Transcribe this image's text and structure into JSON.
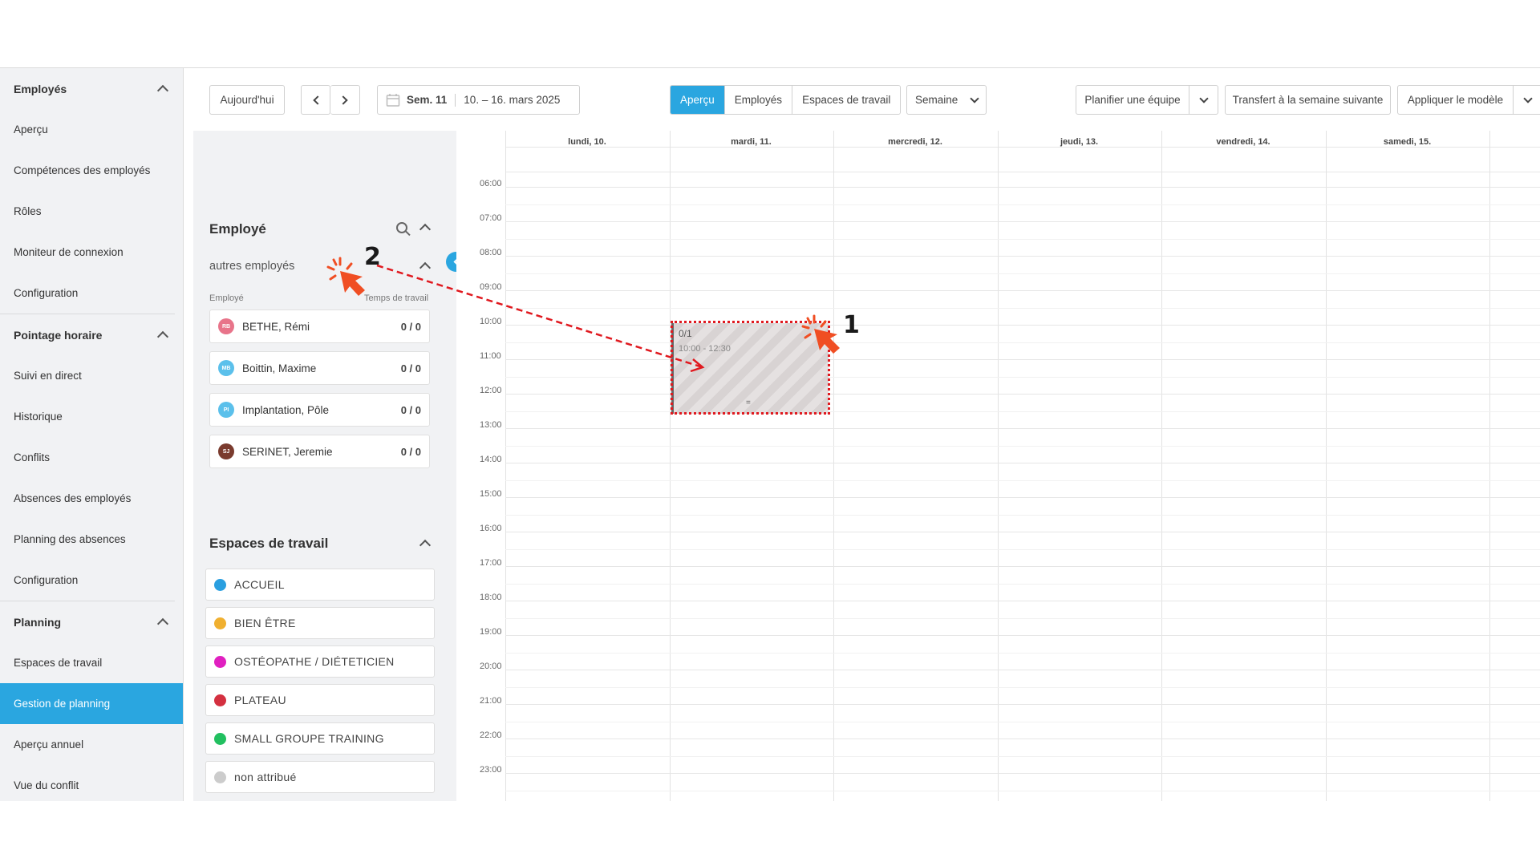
{
  "nav": {
    "sections": [
      {
        "title": "Employés",
        "items": [
          "Aperçu",
          "Compétences des employés",
          "Rôles",
          "Moniteur de connexion",
          "Configuration"
        ]
      },
      {
        "title": "Pointage horaire",
        "items": [
          "Suivi en direct",
          "Historique",
          "Conflits",
          "Absences des employés",
          "Planning des absences",
          "Configuration"
        ]
      },
      {
        "title": "Planning",
        "items": [
          "Espaces de travail",
          "Gestion de planning",
          "Aperçu annuel",
          "Vue du conflit"
        ]
      }
    ],
    "active_item": "Gestion de planning"
  },
  "toolbar": {
    "today": "Aujourd'hui",
    "week_number": "Sem. 11",
    "week_range": "10. – 16. mars 2025",
    "view_tabs": [
      "Aperçu",
      "Employés",
      "Espaces de travail"
    ],
    "active_view": "Aperçu",
    "period": "Semaine",
    "plan_team": "Planifier une équipe",
    "transfer": "Transfert à la semaine suivante",
    "apply_template": "Appliquer le modèle"
  },
  "employee_panel": {
    "title": "Employé",
    "group": "autres employés",
    "col_employee": "Employé",
    "col_time": "Temps de travail",
    "employees": [
      {
        "initials": "RB",
        "name": "BETHE, Rémi",
        "time": "0 / 0",
        "color": "#e8748a"
      },
      {
        "initials": "MB",
        "name": "Boittin, Maxime",
        "time": "0 / 0",
        "color": "#5bc0eb"
      },
      {
        "initials": "PI",
        "name": "Implantation, Pôle",
        "time": "0 / 0",
        "color": "#5bc0eb"
      },
      {
        "initials": "SJ",
        "name": "SERINET, Jeremie",
        "time": "0 / 0",
        "color": "#7a3b2e"
      }
    ]
  },
  "workspaces_panel": {
    "title": "Espaces de travail",
    "items": [
      {
        "name": "ACCUEIL",
        "color": "#2a9fe0"
      },
      {
        "name": "BIEN ÊTRE",
        "color": "#f0b030"
      },
      {
        "name": "OSTÉOPATHE / DIÉTETICIEN",
        "color": "#e020c0"
      },
      {
        "name": "PLATEAU",
        "color": "#d43040"
      },
      {
        "name": "SMALL GROUPE TRAINING",
        "color": "#22c060"
      },
      {
        "name": "non attribué",
        "color": "#cccccc"
      }
    ]
  },
  "calendar": {
    "days": [
      "lundi, 10.",
      "mardi, 11.",
      "mercredi, 12.",
      "jeudi, 13.",
      "vendredi, 14.",
      "samedi, 15."
    ],
    "hours": [
      "06:00",
      "07:00",
      "08:00",
      "09:00",
      "10:00",
      "11:00",
      "12:00",
      "13:00",
      "14:00",
      "15:00",
      "16:00",
      "17:00",
      "18:00",
      "19:00",
      "20:00",
      "21:00",
      "22:00",
      "23:00"
    ],
    "shift": {
      "count": "0/1",
      "time": "10:00 - 12:30",
      "grip": "="
    }
  },
  "annotations": {
    "marker_1": "1",
    "marker_2": "2",
    "accent": "#f04e23"
  }
}
